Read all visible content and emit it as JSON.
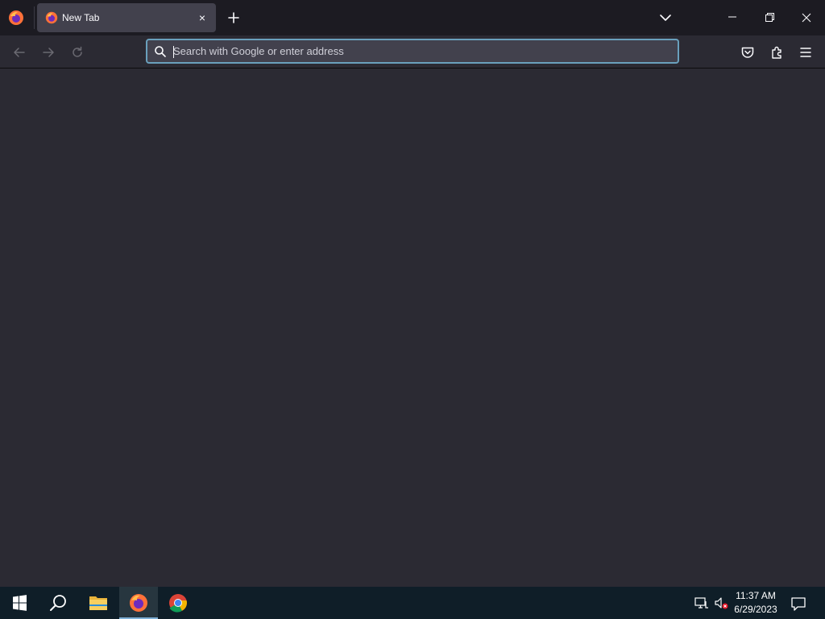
{
  "browser": {
    "tab": {
      "title": "New Tab",
      "close_label": "×"
    },
    "urlbar": {
      "placeholder": "Search with Google or enter address",
      "value": ""
    },
    "colors": {
      "titlebar": "#1c1b22",
      "toolbar": "#2b2a33",
      "tab_active": "#42414d",
      "urlbar_focus_border": "#6aa0bd"
    }
  },
  "taskbar": {
    "clock": {
      "time": "11:37 AM",
      "date": "6/29/2023"
    },
    "apps": [
      "start-icon",
      "search-icon",
      "file-explorer-icon",
      "firefox-icon",
      "chrome-icon"
    ]
  }
}
